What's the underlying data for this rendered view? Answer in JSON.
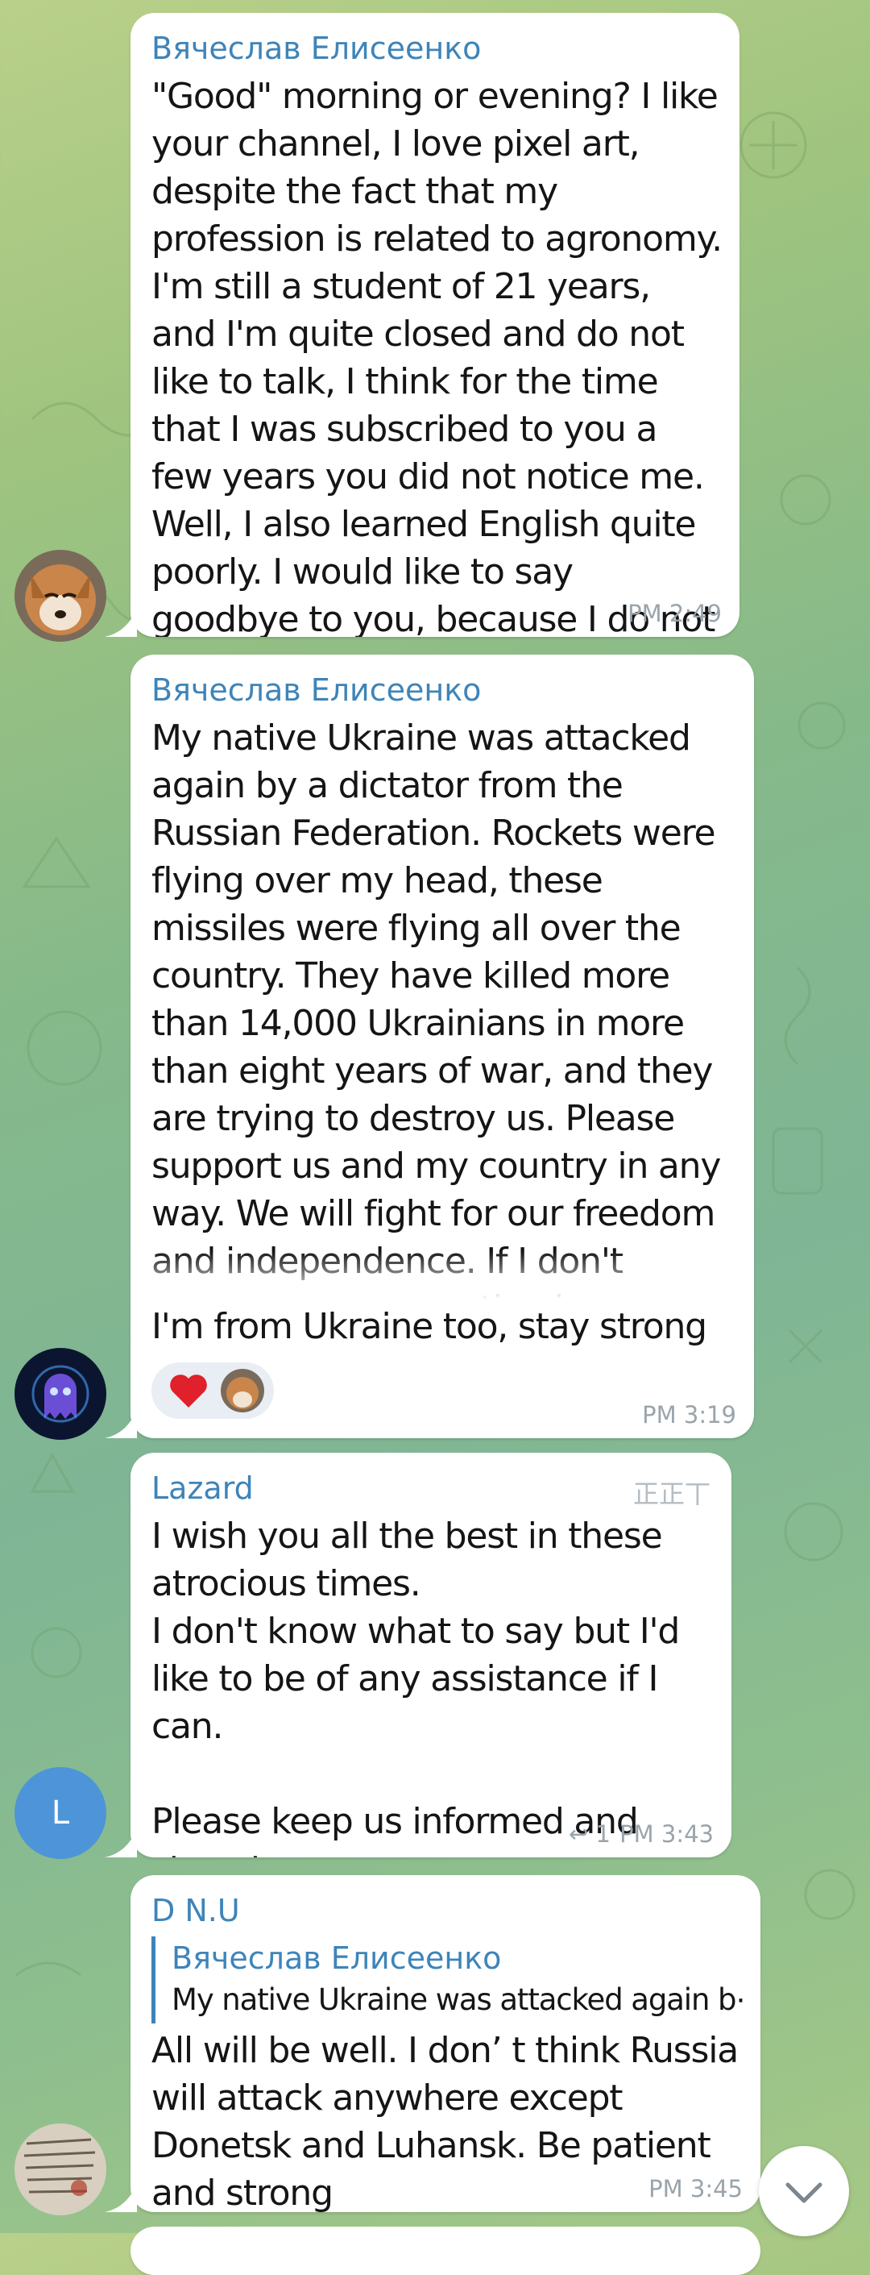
{
  "messages": [
    {
      "sender": "Вячеслав Елисеенко",
      "text": "\"Good\" morning or evening? I like your channel, I love pixel art, despite the fact that my profession is related to agronomy. I'm still a student of 21 years, and I'm quite closed and do not like to talk, I think for the time that I was subscribed to you a few years you did not notice me. Well, I also learned English quite poorly. I would like to say goodbye to you, because I do not know what will happen next.",
      "time": "PM 2:49"
    },
    {
      "sender": "Вячеслав Елисеенко",
      "text": "My native Ukraine was attacked again by a dictator from the Russian Federation. Rockets were flying over my head, these missiles were flying all over the country. They have killed more than 14,000 Ukrainians in more than eight years of war, and they are trying to destroy us. Please support us and my country in any way. We will fight for our freedom and independence. If I don't answer, my connection is probably lost in my city,"
    },
    {
      "text": "I'm from Ukraine too, stay strong",
      "reactions": [
        "heart",
        "fox-avatar"
      ],
      "time": "PM 3:19"
    },
    {
      "sender": "Lazard",
      "tag": "正正丅",
      "text": "I wish you all the best in these atrocious times.\nI don't know what to say but I'd like to be of any assistance if I can.\n\nPlease keep us informed and stay strong.",
      "reply_count": "1",
      "time": "PM 3:43",
      "avatar_letter": "L"
    },
    {
      "sender": "D N.U",
      "quote_sender": "Вячеслав Елисеенко",
      "quote_text": "My native Ukraine was attacked again b⋯",
      "text": "All will be well. I don’ t think Russia will attack anywhere except Donetsk and Luhansk. Be patient and strong",
      "time": "PM 3:45"
    }
  ],
  "colors": {
    "accent": "#3e84b9",
    "avatar_l": "#4d95d8",
    "heart": "#e0202a"
  }
}
